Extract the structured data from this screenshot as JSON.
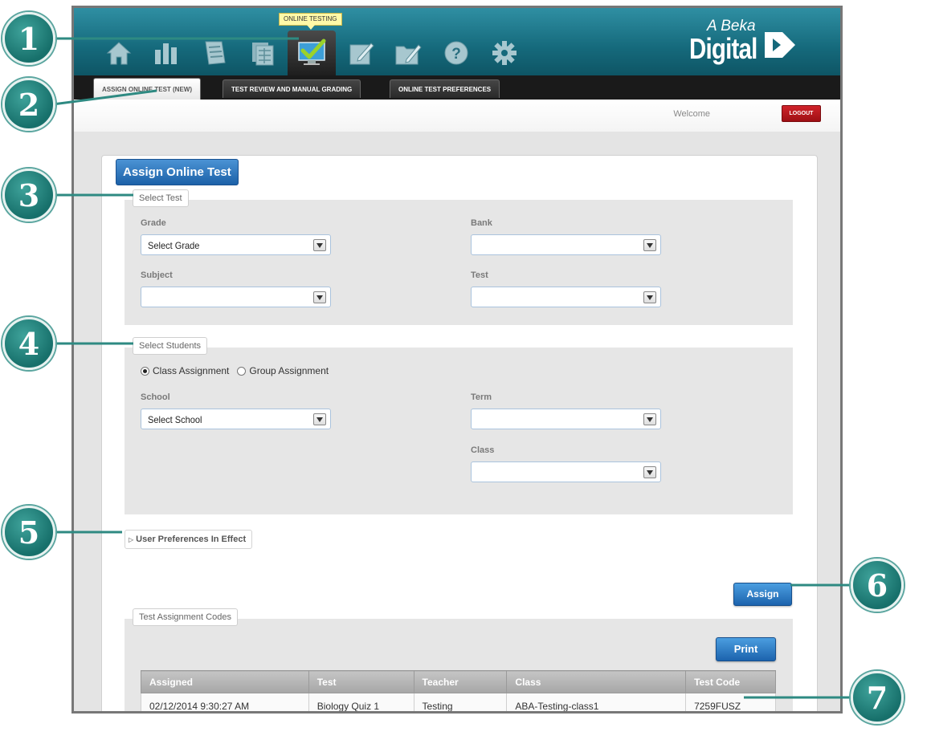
{
  "header": {
    "tooltip": "ONLINE TESTING",
    "nav_icons": [
      "home-icon",
      "chart-icon",
      "notebook-icon",
      "spreadsheet-icon",
      "online-testing-icon",
      "edit-notebook-icon",
      "folder-edit-icon",
      "help-icon",
      "settings-gear-icon"
    ],
    "logo_small": "A Beka",
    "logo_big": "Digital",
    "colors": {
      "teal": "#15697b",
      "accent_green": "#9bd22a",
      "logout_red": "#b7151b",
      "button_blue": "#1c63ad"
    }
  },
  "subnav": {
    "tabs": [
      "ASSIGN ONLINE TEST (NEW)",
      "TEST REVIEW AND MANUAL GRADING",
      "ONLINE TEST PREFERENCES"
    ]
  },
  "welcome_bar": {
    "welcome": "Welcome",
    "logout": "LOGOUT"
  },
  "panel": {
    "title": "Assign Online Test",
    "select_test": {
      "legend": "Select Test",
      "grade_label": "Grade",
      "grade_value": "Select Grade",
      "bank_label": "Bank",
      "bank_value": "",
      "subject_label": "Subject",
      "subject_value": "",
      "test_label": "Test",
      "test_value": ""
    },
    "select_students": {
      "legend": "Select Students",
      "class_assignment": "Class Assignment",
      "group_assignment": "Group Assignment",
      "school_label": "School",
      "school_value": "Select School",
      "term_label": "Term",
      "term_value": "",
      "class_label": "Class",
      "class_value": ""
    },
    "preferences": "User Preferences In Effect",
    "assign_button": "Assign",
    "codes": {
      "legend": "Test Assignment Codes",
      "print_button": "Print",
      "columns": [
        "Assigned",
        "Test",
        "Teacher",
        "Class",
        "Test Code"
      ],
      "rows": [
        [
          "02/12/2014 9:30:27 AM",
          "Biology Quiz 1",
          "Testing",
          "ABA-Testing-class1",
          "7259FUSZ"
        ]
      ]
    }
  },
  "callouts": [
    "1",
    "2",
    "3",
    "4",
    "5",
    "6",
    "7"
  ]
}
